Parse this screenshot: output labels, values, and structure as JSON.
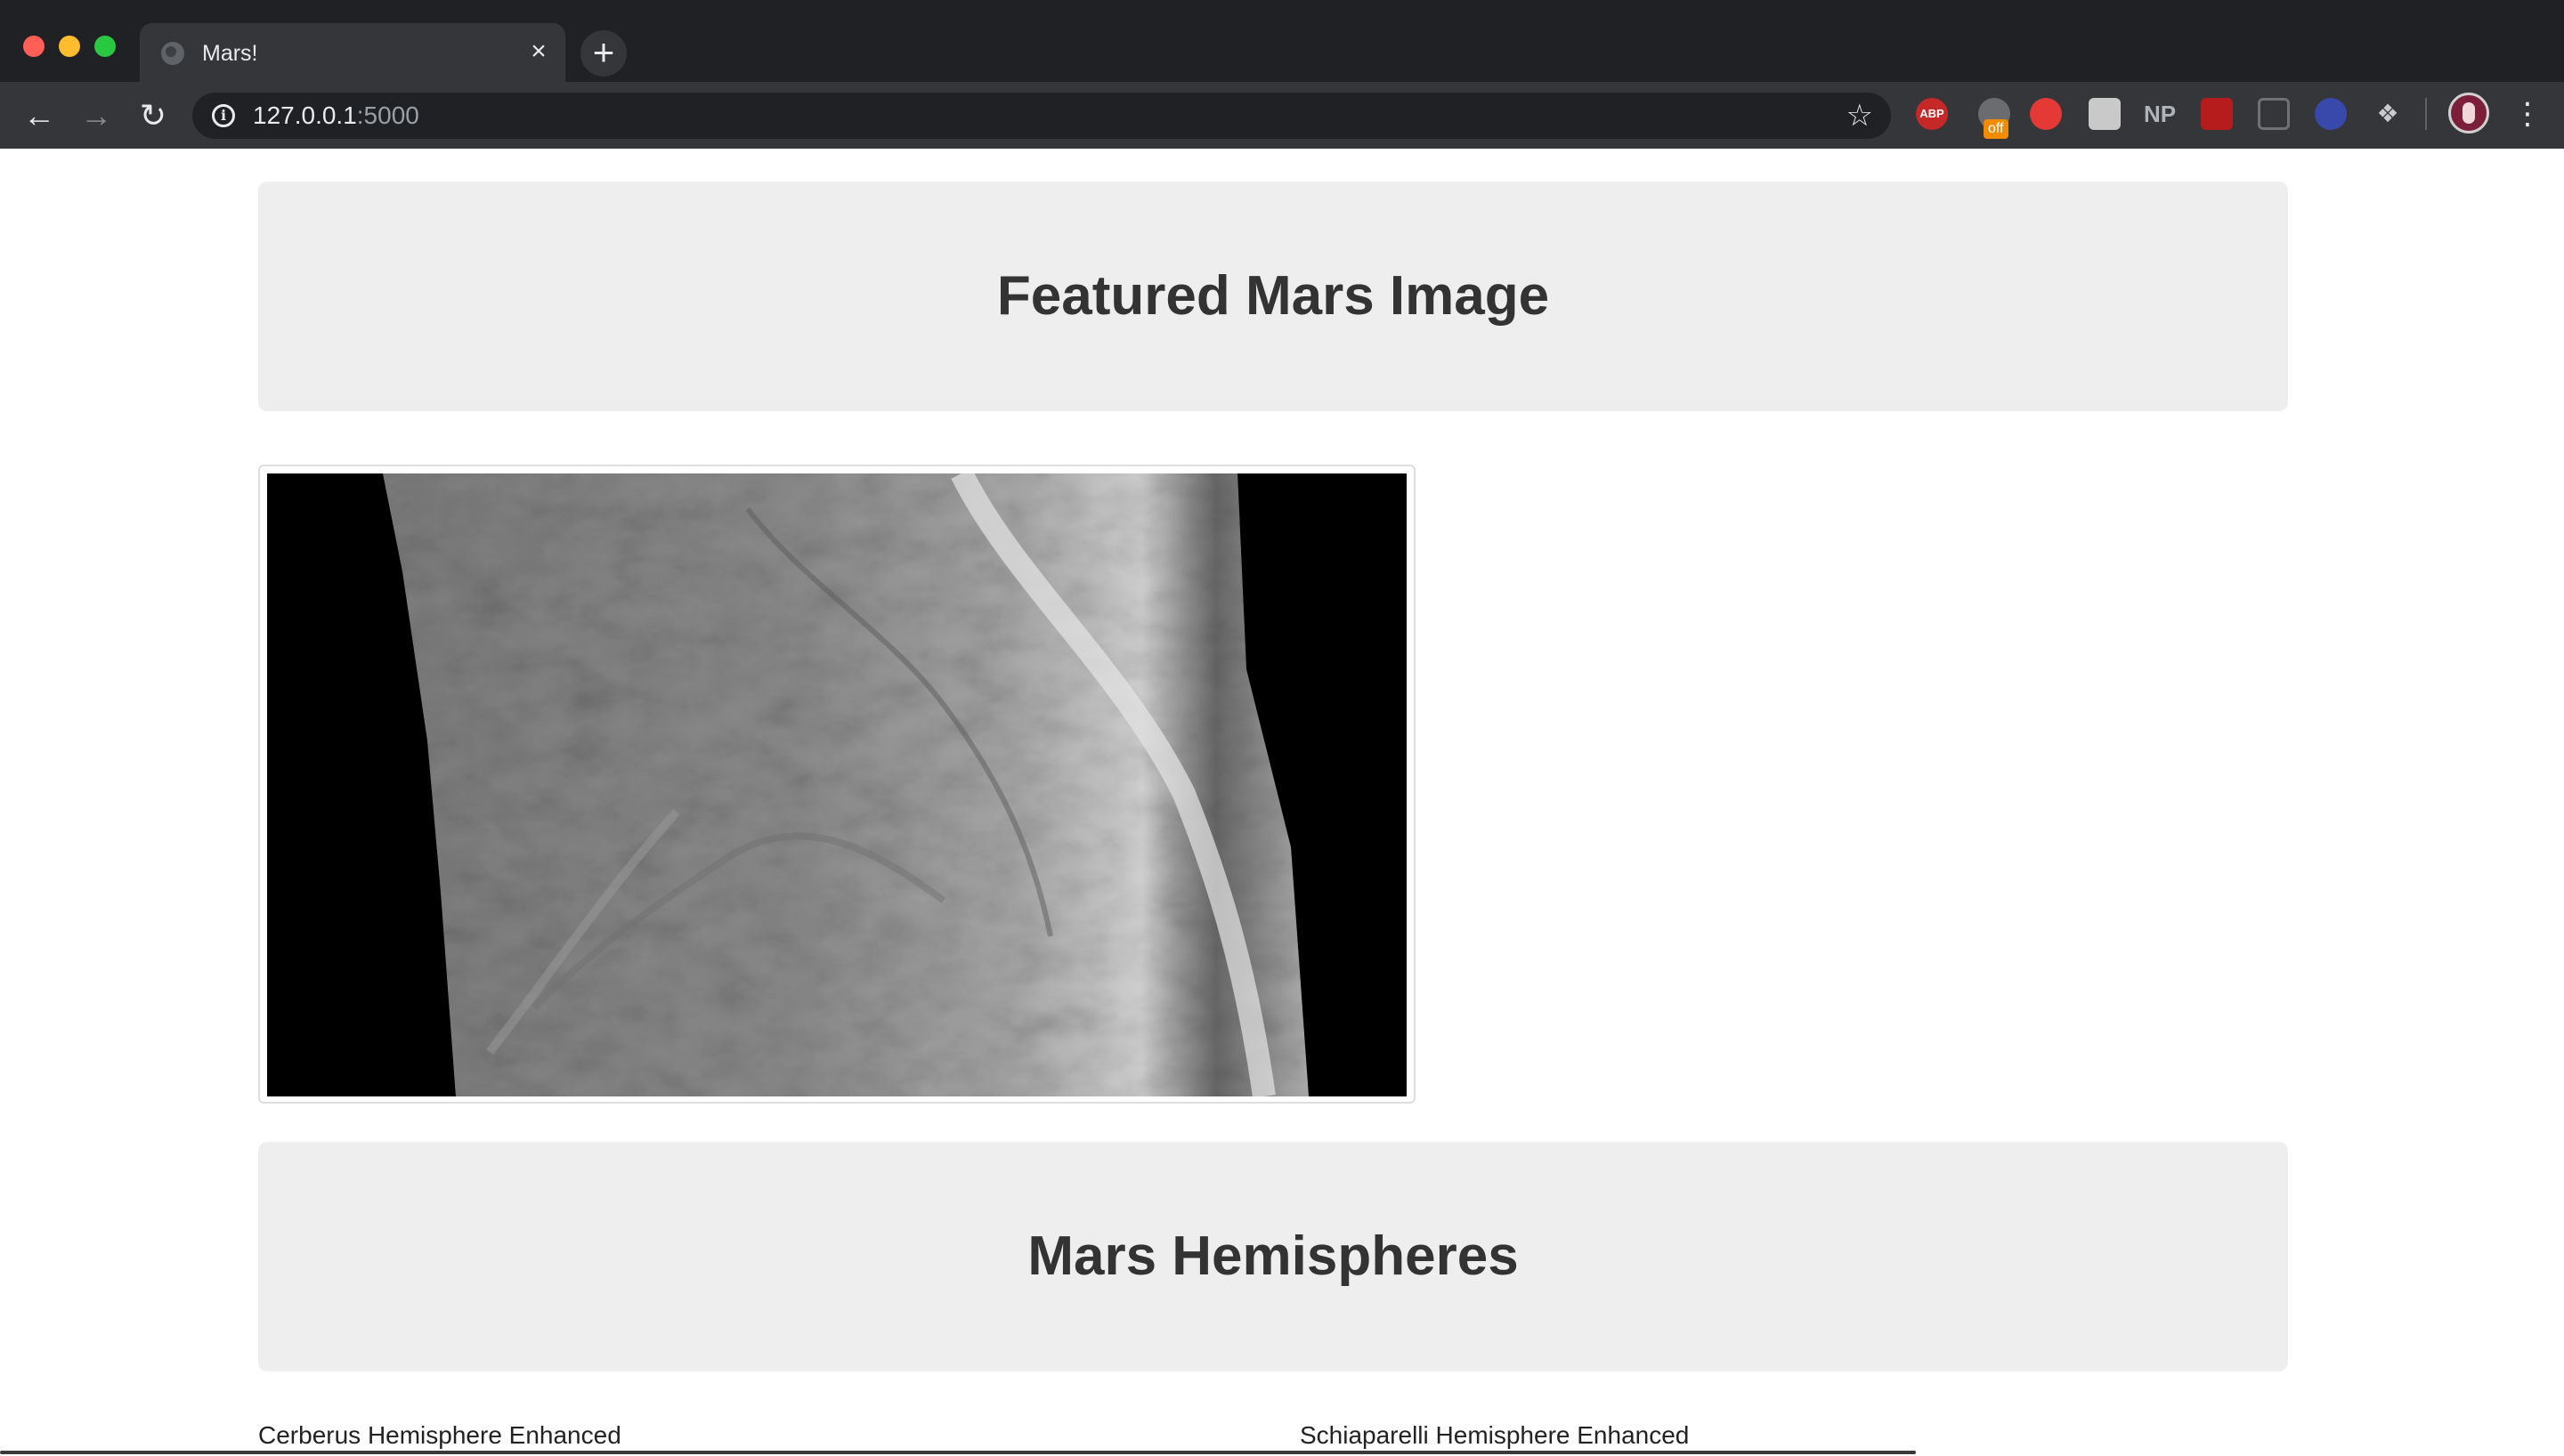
{
  "browser": {
    "tab_title": "Mars!",
    "tab_close": "×",
    "new_tab": "+",
    "url_host": "127.0.0.1",
    "url_port": ":5000",
    "back_glyph": "←",
    "forward_glyph": "→",
    "reload_glyph": "↻",
    "star_glyph": "☆",
    "menu_glyph": "⋮",
    "extensions": {
      "abp": "ABP",
      "ghost_badge": "off",
      "np": "NP"
    },
    "icons": [
      "globe-icon",
      "info-icon",
      "star-icon",
      "adblock-icon",
      "ghostery-icon",
      "stop-icon",
      "cube-icon",
      "np-icon",
      "red-extension-icon",
      "doc-icon",
      "flag-icon",
      "dropbox-icon",
      "avatar",
      "menu-icon"
    ]
  },
  "featured": {
    "heading": "Featured Mars Image"
  },
  "hemispheres": {
    "heading": "Mars Hemispheres",
    "items": [
      {
        "title": "Cerberus Hemisphere Enhanced"
      },
      {
        "title": "Schiaparelli Hemisphere Enhanced"
      }
    ]
  }
}
